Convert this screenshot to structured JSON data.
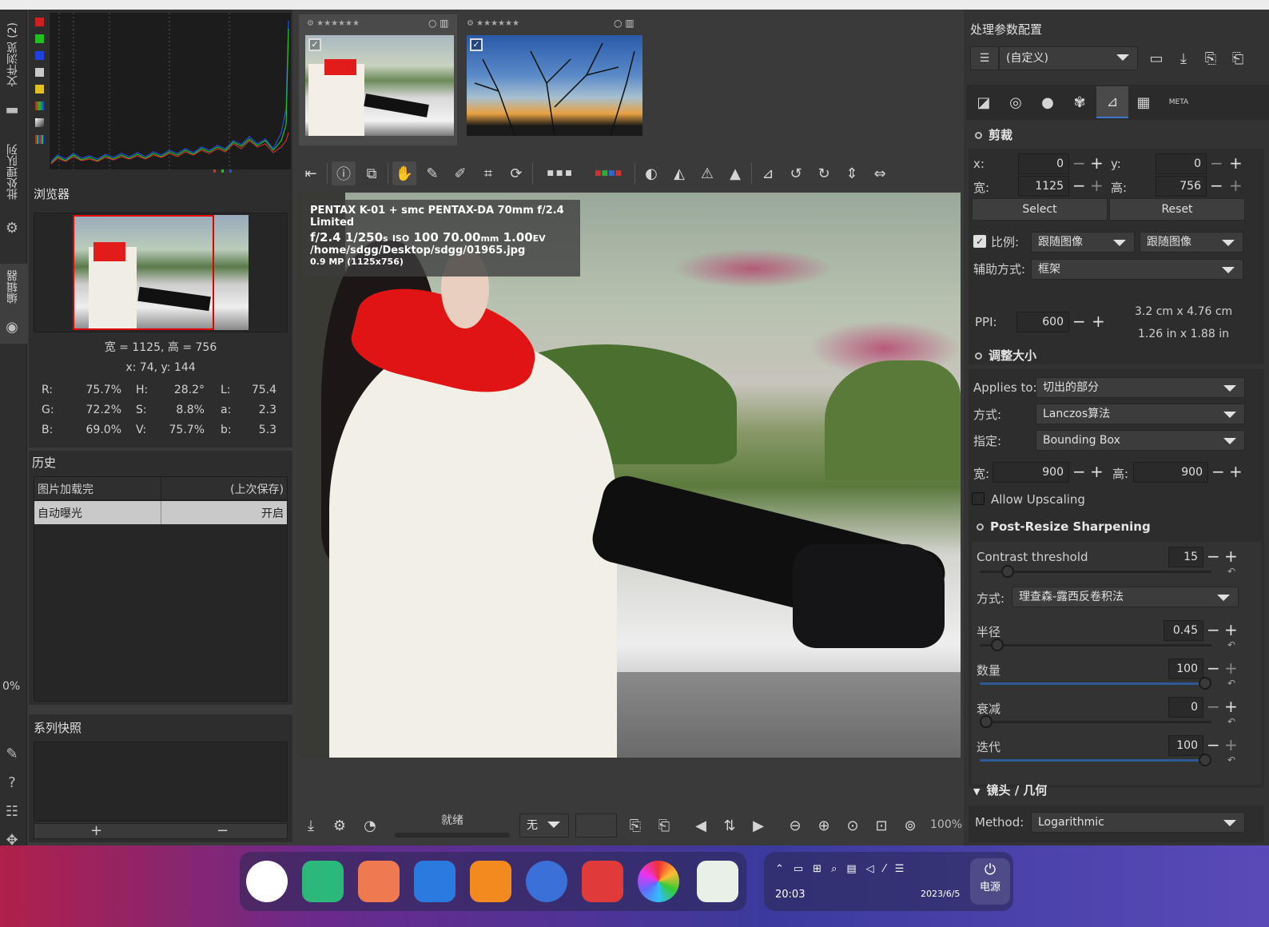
{
  "left_tabs": {
    "file_browser": "文件浏览 (2)",
    "batch_queue": "批处理队列",
    "editor": "编辑器"
  },
  "colors": {
    "accent": "#3a78c8",
    "bg": "#3a3a3a",
    "panel": "#2d2d2d",
    "selected": "#4a4a4a"
  },
  "navigator": {
    "title": "浏览器",
    "size_text": "宽 = 1125, 高 = 756",
    "coord_text": "x: 74, y: 144",
    "rows": [
      {
        "k1": "R:",
        "v1": "75.7%",
        "k2": "H:",
        "v2": "28.2°",
        "k3": "L:",
        "v3": "75.4"
      },
      {
        "k1": "G:",
        "v1": "72.2%",
        "k2": "S:",
        "v2": "8.8%",
        "k3": "a:",
        "v3": "2.3"
      },
      {
        "k1": "B:",
        "v1": "69.0%",
        "k2": "V:",
        "v2": "75.7%",
        "k3": "b:",
        "v3": "5.3"
      }
    ]
  },
  "history": {
    "title": "历史",
    "items": [
      {
        "name": "图片加载完",
        "value": "(上次保存)"
      },
      {
        "name": "自动曝光",
        "value": "开启"
      }
    ]
  },
  "snapshots": {
    "title": "系列快照",
    "add": "+",
    "remove": "−"
  },
  "zero_pct": "0%",
  "image_info": {
    "line1": "PENTAX K-01 + smc PENTAX-DA 70mm f/2.4 Limited",
    "fnum": "f/2.4",
    "shutter": "1/250",
    "shutter_unit": "s",
    "iso_label": "ISO",
    "iso": "100",
    "focal": "70.00",
    "focal_unit": "mm",
    "ev": "1.00",
    "ev_unit": "EV",
    "path": "/home/sdgg/Desktop/sdgg/01965.jpg",
    "mp": "0.9 MP (1125x756)"
  },
  "bottom_bar": {
    "status": "就绪",
    "combo_value": "无",
    "zoom": "100%"
  },
  "right": {
    "profile_title": "处理参数配置",
    "profile_value": "(自定义)",
    "crop": {
      "title": "剪裁",
      "x_label": "x:",
      "x": "0",
      "y_label": "y:",
      "y": "0",
      "w_label": "宽:",
      "w": "1125",
      "h_label": "高:",
      "h": "756",
      "select": "Select",
      "reset": "Reset",
      "ratio_label": "比例:",
      "ratio_a": "跟随图像",
      "ratio_b": "跟随图像",
      "guide_label": "辅助方式:",
      "guide": "框架",
      "ppi_label": "PPI:",
      "ppi": "600",
      "size_cm": "3.2 cm x 4.76 cm",
      "size_in": "1.26 in x 1.88 in"
    },
    "resize": {
      "title": "调整大小",
      "applies_label": "Applies to:",
      "applies": "切出的部分",
      "method_label": "方式:",
      "method": "Lanczos算法",
      "spec_label": "指定:",
      "spec": "Bounding Box",
      "w_label": "宽:",
      "w": "900",
      "h_label": "高:",
      "h": "900",
      "upscale": "Allow Upscaling"
    },
    "sharpen": {
      "title": "Post-Resize Sharpening",
      "contrast_label": "Contrast threshold",
      "contrast": "15",
      "contrast_level": 0.1,
      "method_label": "方式:",
      "method": "理查森-露西反卷积法",
      "radius_label": "半径",
      "radius": "0.45",
      "radius_level": 0.05,
      "amount_label": "数量",
      "amount": "100",
      "amount_level": 1.0,
      "damping_label": "衰减",
      "damping": "0",
      "damping_level": 0.0,
      "iter_label": "迭代",
      "iter": "100",
      "iter_level": 1.0
    },
    "lens": {
      "title": "镜头 / 几何",
      "method_label": "Method:",
      "method": "Logarithmic"
    }
  },
  "taskbar": {
    "time": "20:03",
    "date": "2023/6/5",
    "power": "电源"
  }
}
